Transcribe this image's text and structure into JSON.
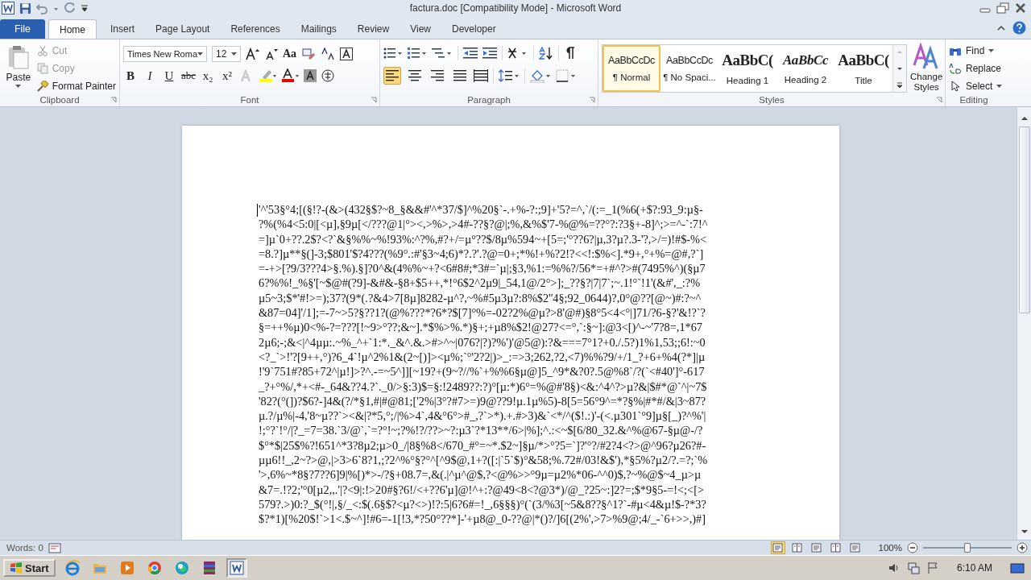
{
  "window": {
    "title": "factura.doc [Compatibility Mode]  -  Microsoft Word"
  },
  "tabs": [
    {
      "label": "File",
      "kind": "file",
      "selected": false
    },
    {
      "label": "Home",
      "kind": "tab",
      "selected": true
    },
    {
      "label": "Insert",
      "kind": "tab",
      "selected": false
    },
    {
      "label": "Page Layout",
      "kind": "tab",
      "selected": false
    },
    {
      "label": "References",
      "kind": "tab",
      "selected": false
    },
    {
      "label": "Mailings",
      "kind": "tab",
      "selected": false
    },
    {
      "label": "Review",
      "kind": "tab",
      "selected": false
    },
    {
      "label": "View",
      "kind": "tab",
      "selected": false
    },
    {
      "label": "Developer",
      "kind": "tab",
      "selected": false
    }
  ],
  "clipboard": {
    "label": "Clipboard",
    "paste": "Paste",
    "cut": {
      "label": "Cut",
      "disabled": true
    },
    "copy": {
      "label": "Copy",
      "disabled": true
    },
    "format_painter": {
      "label": "Format Painter",
      "disabled": false
    }
  },
  "font": {
    "label": "Font",
    "font_name": "Times New Roma",
    "font_size": "12",
    "change_case": "Aa",
    "format_buttons": [
      "B",
      "I",
      "U",
      "abc",
      "x₂",
      "x²"
    ]
  },
  "paragraph": {
    "label": "Paragraph",
    "alignment": [
      {
        "selected": true
      },
      {
        "selected": false
      },
      {
        "selected": false
      },
      {
        "selected": false
      }
    ]
  },
  "styles": {
    "label": "Styles",
    "items": [
      {
        "sample": "AaBbCcDc",
        "name": "¶ Normal",
        "kind": "body",
        "selected": true
      },
      {
        "sample": "AaBbCcDc",
        "name": "¶ No Spaci...",
        "kind": "body",
        "selected": false
      },
      {
        "sample": "AaBbC(",
        "name": "Heading 1",
        "kind": "heading",
        "selected": false
      },
      {
        "sample": "AaBbCc",
        "name": "Heading 2",
        "kind": "italic",
        "selected": false
      },
      {
        "sample": "AaBbC(",
        "name": "Title",
        "kind": "heading",
        "selected": false
      }
    ],
    "change_styles": "Change Styles"
  },
  "editing": {
    "label": "Editing",
    "find": "Find",
    "replace": "Replace",
    "select": "Select"
  },
  "document": {
    "lines": [
      "'^'53§°4;[(§!?-(&>(432§$?~8_§&&#'^*37/$]^%20§`-.+%-?:;9]+'5?=^,`/(:=_1(%6(+$?:93_9:µ§-",
      "?%(%4<5:0|[<µ],§9µ[</???@1|°><,>%>,>4#-??§?@|;%,&%$'7-%@%=??°?:?3§+-8]^;>=^-`:7!^",
      "=]µ`0+??.2$?<?`&§%%~%!93%:^?%,#?+/=µ°??$/8µ%594~+[5=;'°??6?|µ,3?µ?.3-'?,>/=)!#$-%<",
      "=8.?]µ**§(]-3;$801'$?4???(%9°.:#'§3~4;6)*?.?'.?@=0+;*%!+%?2!?<<!:$%<].*9+,°+%=@#,?`]",
      "=-+>[?9/3???4>§.%).§]?0^&(4%%~+?<6#8#;*3#=`µ|;§3,%1:=%%?/56*=+#^?>#(7495%^)(§µ7",
      "6?%%!_%§'[~$@#(?9]-&#&-§8+$5++,*!°6$2^2µ9|_54,1@/2°>];_??§?|7|7`;~.1!°`!1'(&#',_:?%",
      "µ5~3;$*'#!>=);37?(9*(.?&4>7[8µ]8282-µ^?,~%#5µ3µ?:8%$2''4§;92_0644)?,0°@??[@~)#:?~^",
      "&87=04]'/1];=-7~>5?§??1?(@%???*?6*?$[7]°%=-02?2%@µ?>8'@#)§8°5<4<°|]71/?6-§?'&!?`?",
      "§=++%µ)0<%-?=???[!~9>°??;&~].*$%>%.*)§+;+µ8%$2!@27?<=°,`:§~]:@3<[)^-~'7?8=,1*67",
      "2µ6;-;&<|^4µµ:.~%_^+`1:*._&^.&.>#>^~|076?|?)?%')'@5@):?&===7°1?+0./.5?)1%1,53;;6!:~0",
      "<?_`>!'?[9++,°)?6_4`!µ^2%1&(2~[)]><µ%;`°'2?2|)>_:=>3;262,?2,<7)%%?9/+/1_?+6+%4(?*]|µ",
      "!'9`751#?85+72^|µ!]>?^.-=~5^]][~19?+(9~?//%`+%%6§µ@]5_^9*&?0?.5@%8`/?(`<#40']°-617",
      "_?+°%/,*+<#-_64&??4.?`._0/>§:3)$=§:!2489??:?)°[µ:*)6°=%@#'8§)<&:^4^?>µ?&|$#*@`^|~7$",
      "'82?(°(])?$6?-]4&(?/*§1,#|#@81;['2%|3°?#7>=)9@??9!µ.1µ%5)-8[5=56°9^=*?§%|#*#/&|3~87?",
      "µ.?/µ%|-4,'8~µ??`><&|?*5,°;/|%>4`,4&°6°>#_,?`>*).+.#>3)&`<*/^($!.:)'-(<.µ301`°9]µ§[_)?^%'|",
      "!;°?`!°/|?_=7=38.`3/@`,`=?°!~;?%!?/??>~?:µ3`?*13**/6>|%];^.:<~$[6/80_32.&^%@67-§µ@-/?",
      "$°*$|25$%?!651^*3?8µ2;µ>0_/|8§%8</670_#°=~*.$2~]§µ/*>°?5=`]?'°?/#2?4<?>@^96?µ26?#-",
      "µµ6!!_,2~?>@,|>3>6`8?1,;?2^%°§?°^[^9$@,1+?([:|`5`$)°&58;%.72#/03!&$'),*§5%?µ2/?.=?;`%",
      "'>,6%~*8§?7??6]9|%[)*>-/?§+08.7=,&(.|^µ^@$,?<@%>>°9µ=µ2%*06-^^0)$,?~%@$~4_µ>µ",
      "&7=.!?2;'°0[µ2,,.'|?<9|:!>20#§?6!/<+??6'µ]@!^+:?@49<8<?@3*)/@_?25~:]2?=;$*9§5-=!<;<[>",
      "579?.>)0:?_$(°!|,§/_<:$(.6§$?<µ?<>)!?:5|6?6#=!_,6§§§)°(`(3/%3[~5&8??§^1?`-#µ<4&µ!$-?*3?",
      "$?*1)[%20$!`>1<.$~^]!#6=-1[!3,*?50°??*]-'+µ8@_0-??@|*()?/]6[(2%',>7>%9@;4/_-`6+>>,)#]"
    ]
  },
  "status_bar": {
    "words": "Words: 0",
    "views": [
      {
        "selected": true
      },
      {
        "selected": false
      },
      {
        "selected": false
      },
      {
        "selected": false
      },
      {
        "selected": false
      }
    ],
    "zoom": "100%",
    "zoom_slider": {
      "level": 0.5
    }
  },
  "taskbar": {
    "start": "Start",
    "apps": [
      {
        "kind": "ie",
        "selected": false
      },
      {
        "kind": "folder",
        "selected": false
      },
      {
        "kind": "media",
        "selected": false
      },
      {
        "kind": "chrome",
        "selected": false
      },
      {
        "kind": "edge",
        "selected": false
      },
      {
        "kind": "winrar",
        "selected": false
      },
      {
        "kind": "word",
        "selected": true
      }
    ],
    "clock": "6:10 AM"
  }
}
